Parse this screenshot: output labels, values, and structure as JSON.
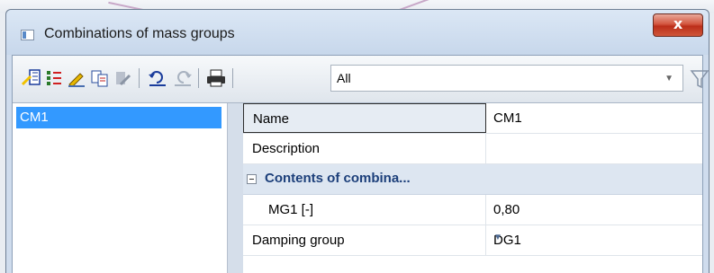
{
  "window": {
    "title": "Combinations of mass groups",
    "close_label": "x"
  },
  "toolbar": {
    "filter_value": "All",
    "icons": [
      "new-item-icon",
      "insert-icon",
      "edit-icon",
      "copy-icon",
      "delete-icon",
      "undo-icon",
      "redo-icon",
      "print-icon",
      "filter-icon"
    ]
  },
  "list": {
    "items": [
      {
        "label": "CM1",
        "selected": true
      }
    ]
  },
  "properties": {
    "rows": [
      {
        "name": "Name",
        "value": "CM1"
      },
      {
        "name": "Description",
        "value": ""
      }
    ],
    "group": {
      "label": "Contents of combina...",
      "rows": [
        {
          "name": "MG1 [-]",
          "value": "0,80"
        }
      ]
    },
    "damping": {
      "name": "Damping group",
      "value": "DG1"
    }
  },
  "colors": {
    "selection": "#3399ff",
    "group_text": "#1c3f7a",
    "close_red": "#c83b23"
  }
}
